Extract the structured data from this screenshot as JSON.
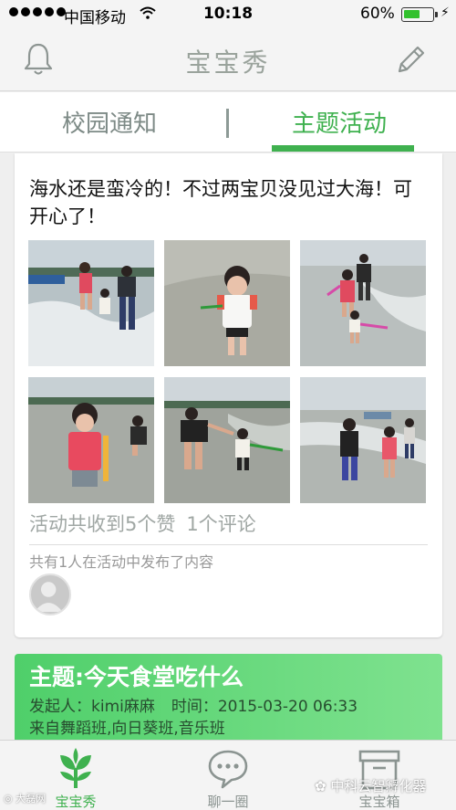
{
  "status_bar": {
    "carrier": "中国移动",
    "time": "10:18",
    "battery_percent_text": "60%",
    "battery_level": 0.6
  },
  "nav": {
    "title": "宝宝秀"
  },
  "tabs": [
    {
      "label": "校园通知",
      "active": false
    },
    {
      "label": "主题活动",
      "active": true
    }
  ],
  "activity_card": {
    "message": "海水还是蛮冷的！不过两宝贝没见过大海！可开心了！",
    "photo_count": 6,
    "likes_text": "活动共收到5个赞",
    "comments_text": "1个评论",
    "participants_text": "共有1人在活动中发布了内容"
  },
  "next_card": {
    "title": "主题:今天食堂吃什么",
    "initiator_label": "发起人：",
    "initiator": "kimi麻麻",
    "time_label": "时间：",
    "time": "2015-03-20 06:33",
    "from_text": "来自舞蹈班,向日葵班,音乐班"
  },
  "tab_bar": [
    {
      "label": "宝宝秀",
      "icon": "sprout-icon",
      "active": true
    },
    {
      "label": "聊一圈",
      "icon": "chat-bubble-icon",
      "active": false
    },
    {
      "label": "宝宝箱",
      "icon": "box-icon",
      "active": false
    }
  ],
  "watermark": {
    "text": "中科云智孵化器",
    "corner_text": "大磊网"
  },
  "colors": {
    "accent": "#3fb14f",
    "nav_title": "#9aa39c",
    "card_gradient_start": "#4fcf6a",
    "card_gradient_end": "#7fe28f"
  }
}
